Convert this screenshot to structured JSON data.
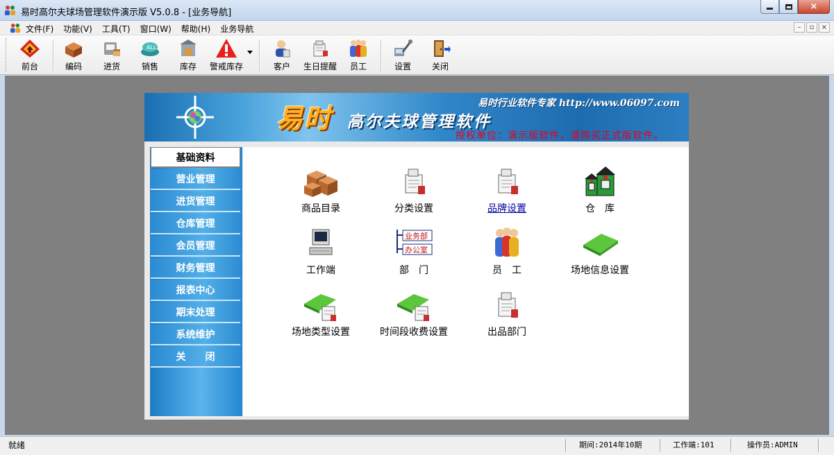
{
  "window": {
    "title": "易时高尔夫球场管理软件演示版 V5.0.8 - [业务导航]",
    "buttons": {
      "minimize": "minimize",
      "maximize": "maximize",
      "close": "×"
    }
  },
  "menubar": {
    "items": [
      "文件(F)",
      "功能(V)",
      "工具(T)",
      "窗口(W)",
      "帮助(H)",
      "业务导航"
    ],
    "mdi_buttons": [
      "–",
      "▫",
      "×"
    ]
  },
  "toolbar": {
    "items": [
      {
        "label": "前台",
        "icon": "front-desk-icon"
      },
      {
        "label": "编码",
        "icon": "boxes-icon"
      },
      {
        "label": "进货",
        "icon": "purchase-icon"
      },
      {
        "label": "销售",
        "icon": "sales-icon"
      },
      {
        "label": "库存",
        "icon": "inventory-icon"
      },
      {
        "label": "警戒库存",
        "icon": "warning-icon"
      },
      {
        "label": "客户",
        "icon": "customer-icon"
      },
      {
        "label": "生日提醒",
        "icon": "birthday-icon"
      },
      {
        "label": "员工",
        "icon": "staff-icon"
      },
      {
        "label": "设置",
        "icon": "settings-icon"
      },
      {
        "label": "关闭",
        "icon": "exit-door-icon"
      }
    ]
  },
  "banner": {
    "brand": "易时",
    "product": "高尔夫球管理软件",
    "slogan": "易时行业软件专家 http://www.06097.com",
    "license": "授权单位：演示版软件，请购买正式版软件。"
  },
  "sidebar": {
    "items": [
      "基础资料",
      "营业管理",
      "进货管理",
      "仓库管理",
      "会员管理",
      "财务管理",
      "报表中心",
      "期末处理",
      "系统维护",
      "关　　闭"
    ],
    "active_index": 0
  },
  "functions": [
    {
      "label": "商品目录",
      "icon": "boxes-icon"
    },
    {
      "label": "分类设置",
      "icon": "printer-doc-icon"
    },
    {
      "label": "品牌设置",
      "icon": "printer-doc-icon"
    },
    {
      "label": "仓　库",
      "icon": "warehouse-icon"
    },
    {
      "label": "工作端",
      "icon": "computer-icon"
    },
    {
      "label": "部　门",
      "icon": "department-tree-icon"
    },
    {
      "label": "员　工",
      "icon": "staff-icon"
    },
    {
      "label": "场地信息设置",
      "icon": "green-field-icon"
    },
    {
      "label": "场地类型设置",
      "icon": "green-field-doc-icon"
    },
    {
      "label": "时间段收费设置",
      "icon": "green-field-doc-icon"
    },
    {
      "label": "出品部门",
      "icon": "printer-doc-icon"
    }
  ],
  "department_tree": [
    "业务部",
    "办公室"
  ],
  "statusbar": {
    "status": "就绪",
    "period": "期间:2014年10期",
    "workstation": "工作端:101",
    "operator": "操作员:ADMIN"
  },
  "colors": {
    "banner_blue": "#2f86c8",
    "sidebar_blue": "#3a9ddf",
    "license_red": "#e8001c",
    "workspace_gray": "#808080"
  }
}
